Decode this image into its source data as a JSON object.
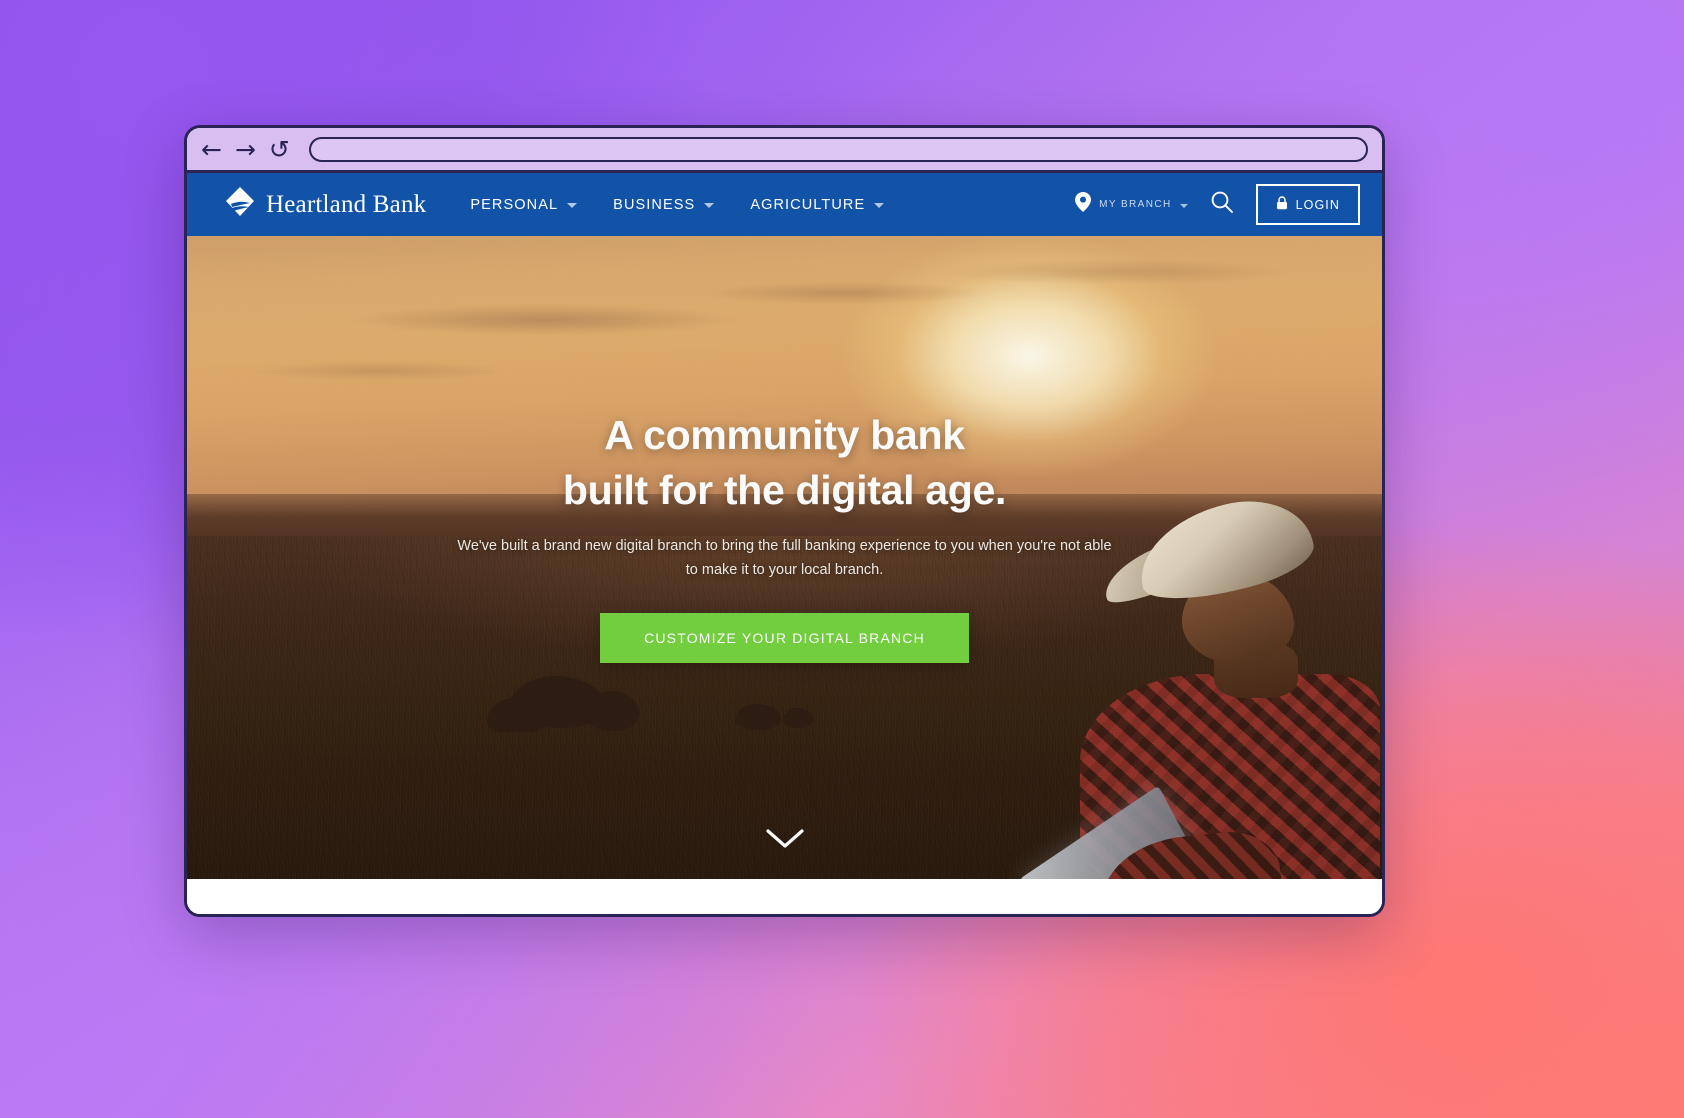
{
  "browser": {
    "back_icon": "arrow-left-icon",
    "forward_icon": "arrow-right-icon",
    "reload_icon": "reload-icon",
    "back_glyph": "←",
    "forward_glyph": "→",
    "reload_glyph": "↺",
    "address_value": "",
    "address_placeholder": ""
  },
  "site": {
    "brand": {
      "name": "Heartland Bank",
      "logo_icon": "heartland-diamond-logo-icon"
    },
    "nav": [
      {
        "label": "PERSONAL",
        "has_dropdown": true
      },
      {
        "label": "BUSINESS",
        "has_dropdown": true
      },
      {
        "label": "AGRICULTURE",
        "has_dropdown": true
      }
    ],
    "header_right": {
      "branch_label": "MY BRANCH",
      "branch_icon": "map-pin-icon",
      "branch_has_dropdown": true,
      "search_icon": "search-icon",
      "login_label": "LOGIN",
      "login_icon": "lock-icon"
    },
    "hero": {
      "headline_line1": "A community bank",
      "headline_line2": "built for the digital age.",
      "subtext": "We've built a brand new digital branch to bring the full banking experience to you when you're not able to make it to your local branch.",
      "cta_label": "CUSTOMIZE YOUR DIGITAL BRANCH",
      "scroll_icon": "chevron-down-icon"
    }
  },
  "colors": {
    "header_blue": "#0d52aa",
    "cta_green": "#73d13d",
    "browser_chrome": "#d9bff1",
    "browser_border": "#2a2356",
    "backdrop_purple": "#8f54ef",
    "backdrop_pink": "#ff7f78",
    "hero_sky": "#dba96e",
    "hero_ground": "#33200f"
  }
}
